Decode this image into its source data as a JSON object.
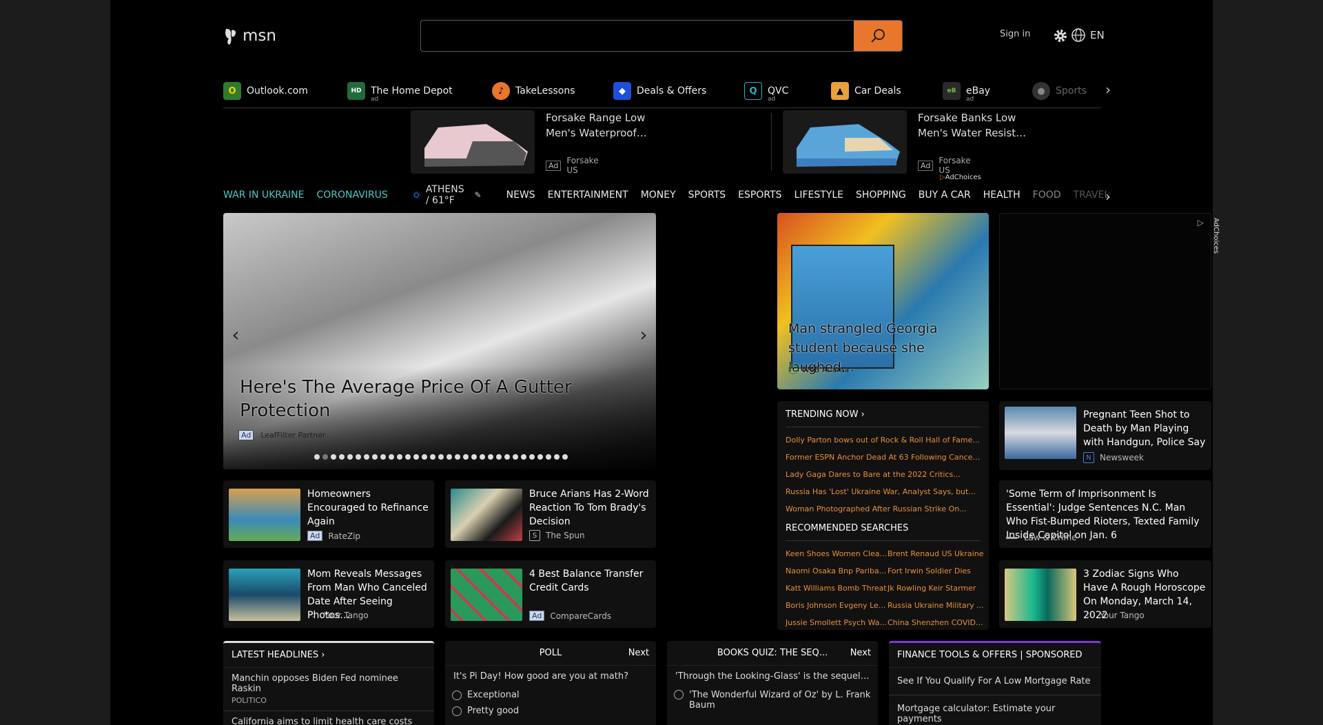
{
  "header": {
    "logo_text": "msn",
    "search_placeholder": "",
    "signin": "Sign in",
    "language": "EN"
  },
  "quick_links": [
    {
      "label": "Outlook.com",
      "icon": "outlook-icon",
      "ad": ""
    },
    {
      "label": "The Home Depot",
      "icon": "home-depot-icon",
      "ad": "ad"
    },
    {
      "label": "TakeLessons",
      "icon": "takelessons-icon",
      "ad": ""
    },
    {
      "label": "Deals & Offers",
      "icon": "deals-icon",
      "ad": ""
    },
    {
      "label": "QVC",
      "icon": "qvc-icon",
      "ad": "ad"
    },
    {
      "label": "Car Deals",
      "icon": "car-deals-icon",
      "ad": ""
    },
    {
      "label": "eBay",
      "icon": "ebay-icon",
      "ad": "ad"
    },
    {
      "label": "Sports",
      "icon": "sports-icon",
      "ad": ""
    }
  ],
  "ads": [
    {
      "title": "Forsake Range Low Men's Waterproof…",
      "tag": "Ad",
      "source": "Forsake US"
    },
    {
      "title": "Forsake Banks Low Men's Water Resist…",
      "tag": "Ad",
      "source": "Forsake US"
    }
  ],
  "adchoices": "AdChoices",
  "nav": {
    "war": "WAR IN UKRAINE",
    "corona": "CORONAVIRUS",
    "weather": "ATHENS / 61°F",
    "categories": [
      "NEWS",
      "ENTERTAINMENT",
      "MONEY",
      "SPORTS",
      "ESPORTS",
      "LIFESTYLE",
      "SHOPPING",
      "BUY A CAR",
      "HEALTH",
      "FOOD",
      "TRAVEL"
    ]
  },
  "hero": {
    "title": "Here's The Average Price Of A Gutter Protection",
    "tag": "Ad",
    "source": "LeafFilter Partner"
  },
  "featured": {
    "title": "Man strangled Georgia student because she laughed…",
    "source": "WSB Atlanta"
  },
  "trending": {
    "heading": "TRENDING NOW",
    "items": [
      "Dolly Parton bows out of Rock & Roll Hall of Fame...",
      "Former ESPN Anchor Dead At 63 Following Cancer...",
      "Lady Gaga Dares to Bare at the 2022 Critics...",
      "Russia Has 'Lost' Ukraine War, Analyst Says, but...",
      "Woman Photographed After Russian Strike On..."
    ],
    "rec_heading": "RECOMMENDED SEARCHES",
    "rec": [
      "Keen Shoes Women Clea...",
      "Brent Renaud US Ukraine",
      "Naomi Osaka Bnp Pariba...",
      "Fort Irwin Soldier Dies",
      "Katt Williams Bomb Threat",
      "Jk Rowling Keir Starmer",
      "Boris Johnson Evgeny Le...",
      "Russia Ukraine Military ...",
      "Jussie Smollett Psych Wa...",
      "China Shenzhen COVID..."
    ]
  },
  "cards": [
    {
      "title": "Homeowners Encouraged to Refinance Again",
      "tag": "Ad",
      "source": "RateZip"
    },
    {
      "title": "Bruce Arians Has 2-Word Reaction To Tom Brady's Decision",
      "tag": "",
      "source": "The Spun"
    },
    {
      "title": "Mom Reveals Messages From Man Who Canceled Date After Seeing Photos…",
      "tag": "",
      "source": "Your Tango"
    },
    {
      "title": "4 Best Balance Transfer Credit Cards",
      "tag": "Ad",
      "source": "CompareCards"
    }
  ],
  "right_cards": [
    {
      "title": "Pregnant Teen Shot to Death by Man Playing with Handgun, Police Say",
      "source": "Newsweek"
    },
    {
      "title": "'Some Term of Imprisonment Is Essential': Judge Sentences N.C. Man Who Fist-Bumped Rioters, Texted Family Inside Capitol on Jan. 6",
      "source": "Law & Crime"
    },
    {
      "title": "3 Zodiac Signs Who Have A Rough Horoscope On Monday, March 14, 2022",
      "source": "Your Tango"
    }
  ],
  "latest": {
    "heading": "LATEST HEADLINES",
    "items": [
      {
        "title": "Manchin opposes Biden Fed nominee Raskin",
        "source": "POLITICO"
      },
      {
        "title": "California aims to limit health care costs with",
        "source": ""
      }
    ]
  },
  "poll": {
    "heading": "POLL",
    "next": "Next",
    "question": "It's Pi Day! How good are you at math?",
    "options": [
      "Exceptional",
      "Pretty good"
    ]
  },
  "quiz": {
    "heading": "BOOKS QUIZ: THE SEQ...",
    "next": "Next",
    "question": "'Through the Looking-Glass' is the sequel to...",
    "options": [
      "'The Wonderful Wizard of Oz' by L. Frank Baum"
    ]
  },
  "finance": {
    "heading": "FINANCE TOOLS & OFFERS | SPONSORED",
    "items": [
      "See If You Qualify For A Low Mortgage Rate",
      "Mortgage calculator: Estimate your payments"
    ]
  }
}
